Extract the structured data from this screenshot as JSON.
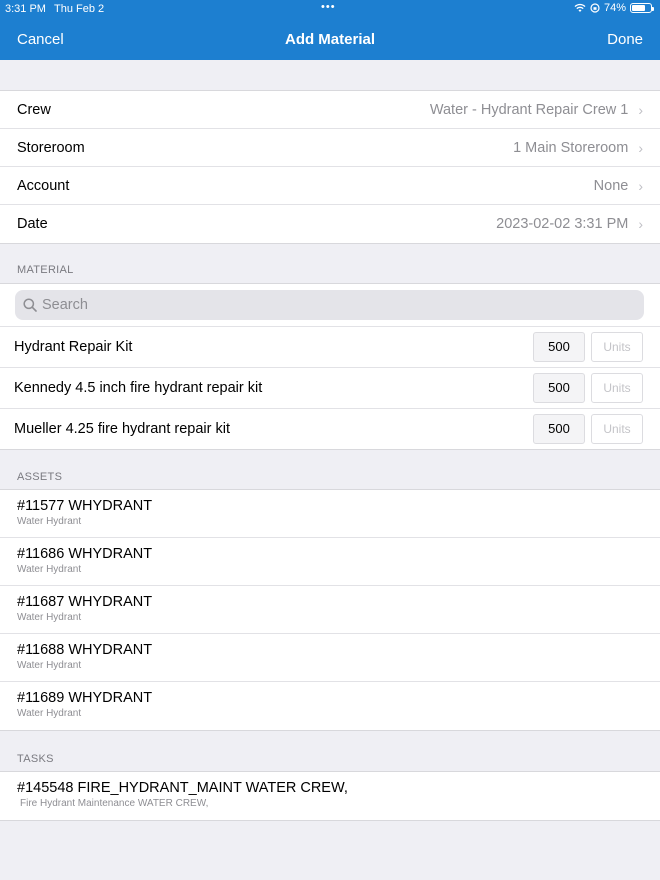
{
  "status": {
    "time": "3:31 PM",
    "date": "Thu Feb 2",
    "battery": "74%",
    "dots": "•••"
  },
  "nav": {
    "cancel": "Cancel",
    "title": "Add Material",
    "done": "Done"
  },
  "details": [
    {
      "label": "Crew",
      "value": "Water - Hydrant Repair Crew 1"
    },
    {
      "label": "Storeroom",
      "value": "1 Main Storeroom"
    },
    {
      "label": "Account",
      "value": "None"
    },
    {
      "label": "Date",
      "value": "2023-02-02 3:31 PM"
    }
  ],
  "material": {
    "header": "MATERIAL",
    "search_placeholder": "Search",
    "items": [
      {
        "name": "Hydrant Repair Kit",
        "qty": "500",
        "units_placeholder": "Units"
      },
      {
        "name": "Kennedy 4.5 inch fire hydrant repair kit",
        "qty": "500",
        "units_placeholder": "Units"
      },
      {
        "name": "Mueller 4.25 fire hydrant repair kit",
        "qty": "500",
        "units_placeholder": "Units"
      }
    ]
  },
  "assets": {
    "header": "ASSETS",
    "items": [
      {
        "title": "#11577 WHYDRANT",
        "subtitle": "Water Hydrant"
      },
      {
        "title": "#11686 WHYDRANT",
        "subtitle": "Water Hydrant"
      },
      {
        "title": "#11687 WHYDRANT",
        "subtitle": "Water Hydrant"
      },
      {
        "title": "#11688 WHYDRANT",
        "subtitle": "Water Hydrant"
      },
      {
        "title": "#11689 WHYDRANT",
        "subtitle": "Water Hydrant"
      }
    ]
  },
  "tasks": {
    "header": "TASKS",
    "items": [
      {
        "title": "#145548 FIRE_HYDRANT_MAINT WATER CREW,",
        "subtitle": "Fire Hydrant Maintenance WATER CREW,"
      }
    ]
  },
  "colors": {
    "accent": "#1d7fd0",
    "background": "#efeff4"
  },
  "icons": {
    "search": "search-icon",
    "chevron": "chevron-right-icon",
    "wifi": "wifi-icon",
    "battery": "battery-icon"
  }
}
